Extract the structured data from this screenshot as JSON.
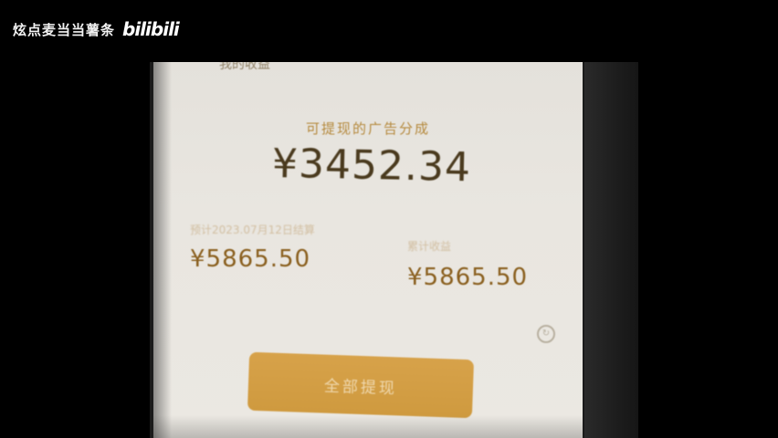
{
  "watermark": {
    "channel_name": "炫点麦当当薯条",
    "logo": "bilibili"
  },
  "screen": {
    "top_title": "我的收益",
    "balance_label": "可提现的广告分成",
    "balance_amount": "¥3452.34",
    "stats": [
      {
        "label": "预计2023.07月12日结算",
        "value": "¥5865.50"
      },
      {
        "label": "累计收益",
        "value": "¥5865.50"
      }
    ],
    "side_icon": "refresh-icon",
    "withdraw_button": "全部提现"
  },
  "colors": {
    "accent_button": "#d39e45",
    "amount_text": "#4a3a1e",
    "value_text": "#8a5f1e",
    "screen_bg": "#e8e5df"
  }
}
